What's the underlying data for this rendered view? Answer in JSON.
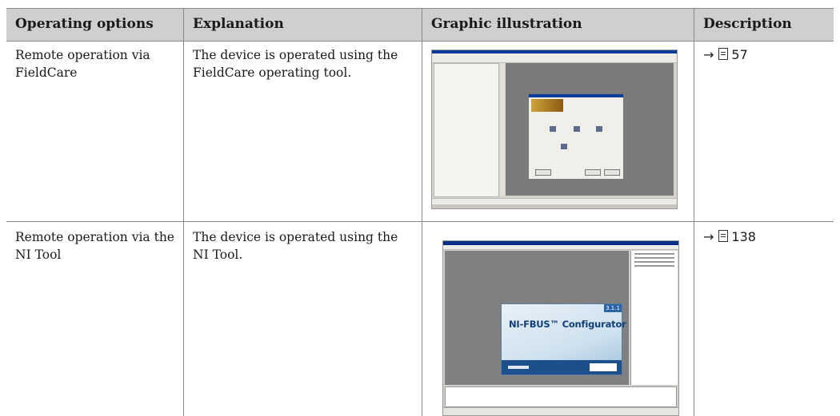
{
  "headers": {
    "operating_options": "Operating options",
    "explanation": "Explanation",
    "graphic": "Graphic illustration",
    "description": "Description"
  },
  "rows": [
    {
      "option": "Remote operation via FieldCare",
      "explanation": "The device is operated using the FieldCare operating tool.",
      "graphic": "fieldcare-screenshot",
      "arrow": "→",
      "page_ref": "57"
    },
    {
      "option": "Remote operation via the NI Tool",
      "explanation": "The device is operated using the NI Tool.",
      "graphic": "ni-configurator-screenshot",
      "arrow": "→",
      "page_ref": "138"
    }
  ],
  "ni_splash": {
    "name": "NI-FBUS™ Configurator",
    "version": "3.1.1"
  },
  "colors": {
    "header_bg": "#cfcfcf",
    "rule": "#8a8a8a"
  }
}
